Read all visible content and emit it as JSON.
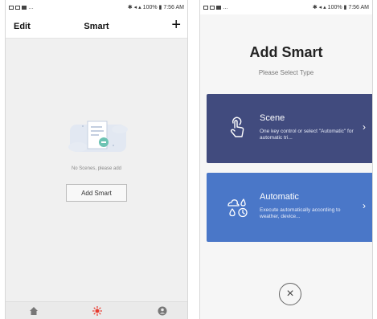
{
  "left_screen": {
    "statusbar": {
      "right_text": "100% ▮ 7:56 AM"
    },
    "header": {
      "edit_label": "Edit",
      "title": "Smart",
      "add_icon": "plus-icon"
    },
    "empty_state": {
      "message": "No Scenes, please add",
      "button_label": "Add Smart"
    },
    "bottom_nav": {
      "items": [
        {
          "icon": "home-icon"
        },
        {
          "icon": "smart-icon",
          "active": true
        },
        {
          "icon": "profile-icon"
        }
      ],
      "active_color": "#e83a2e"
    }
  },
  "right_screen": {
    "statusbar": {
      "right_text": "100% ▮ 7:56 AM"
    },
    "title": "Add Smart",
    "subtitle": "Please Select Type",
    "cards": [
      {
        "title": "Scene",
        "description": "One key control or select \"Automatic\" for automatic tri...",
        "icon": "touch-icon",
        "color": "#414b7e"
      },
      {
        "title": "Automatic",
        "description": "Execute automatically according to weather, device...",
        "icon": "weather-clock-icon",
        "color": "#4a77c8"
      }
    ],
    "close_icon": "close-icon"
  }
}
